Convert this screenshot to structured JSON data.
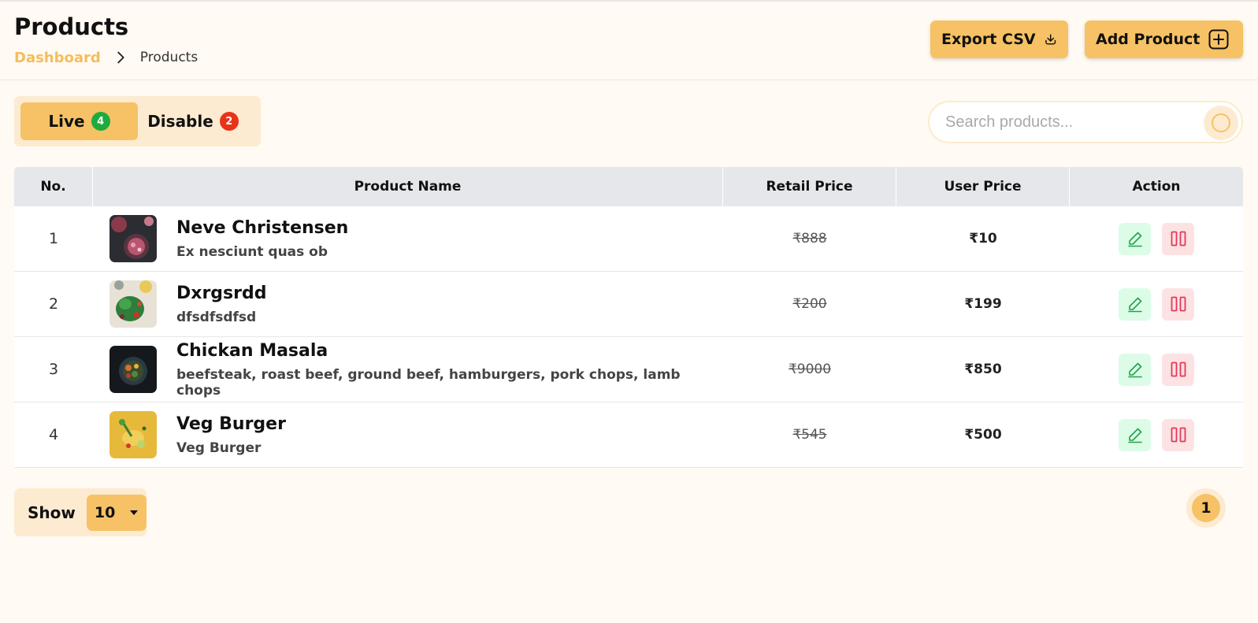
{
  "header": {
    "title": "Products",
    "breadcrumb": {
      "link": "Dashboard",
      "current": "Products"
    },
    "export_label": "Export CSV",
    "add_label": "Add Product"
  },
  "tabs": [
    {
      "label": "Live",
      "count": "4",
      "active": true
    },
    {
      "label": "Disable",
      "count": "2",
      "active": false
    }
  ],
  "search": {
    "placeholder": "Search products..."
  },
  "table": {
    "columns": [
      "No.",
      "Product Name",
      "Retail Price",
      "User Price",
      "Action"
    ],
    "rows": [
      {
        "no": "1",
        "name": "Neve Christensen",
        "desc": "Ex nesciunt quas ob",
        "retail": "₹888",
        "user": "₹10"
      },
      {
        "no": "2",
        "name": "Dxrgsrdd",
        "desc": "dfsdfsdfsd",
        "retail": "₹200",
        "user": "₹199"
      },
      {
        "no": "3",
        "name": "Chickan Masala",
        "desc": "beefsteak, roast beef, ground beef, hamburgers, pork chops, lamb chops",
        "retail": "₹9000",
        "user": "₹850"
      },
      {
        "no": "4",
        "name": "Veg Burger",
        "desc": "Veg Burger",
        "retail": "₹545",
        "user": "₹500"
      }
    ]
  },
  "footer": {
    "show_label": "Show",
    "page_size": "10",
    "current_page": "1"
  },
  "colors": {
    "accent": "#f6c265",
    "accent_light": "#fdebd1",
    "background": "#fffaf3",
    "live_badge": "#1eab3d",
    "disable_badge": "#e8321a",
    "edit_bg": "#dcfce7",
    "delete_bg": "#fde2e4"
  }
}
